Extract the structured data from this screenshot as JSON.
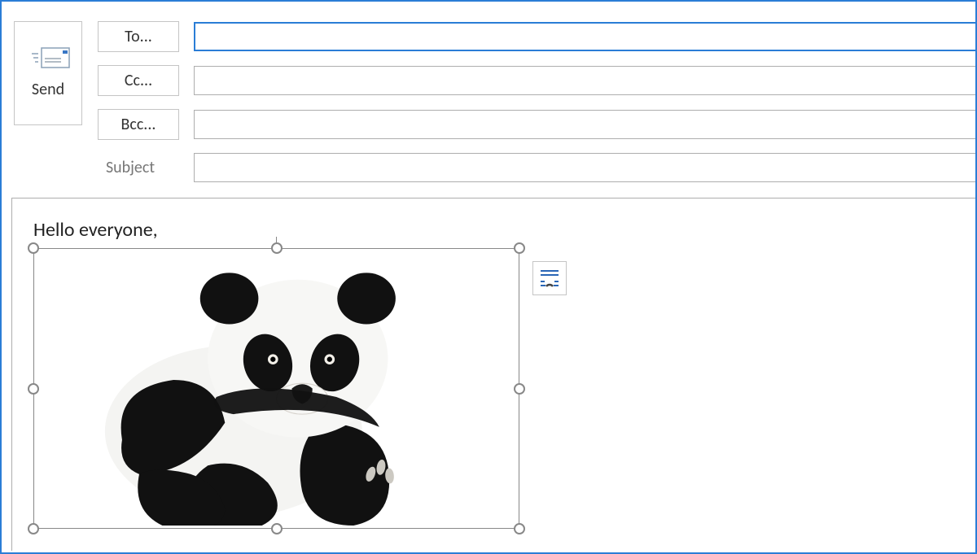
{
  "send": {
    "label": "Send"
  },
  "recipients": {
    "to_button": "To...",
    "cc_button": "Cc...",
    "bcc_button": "Bcc...",
    "to_value": "",
    "cc_value": "",
    "bcc_value": ""
  },
  "subject": {
    "label": "Subject",
    "value": ""
  },
  "body": {
    "greeting": "Hello everyone,"
  },
  "inserted_image": {
    "description": "panda-photo"
  },
  "layout_button": {
    "name": "layout-options"
  }
}
